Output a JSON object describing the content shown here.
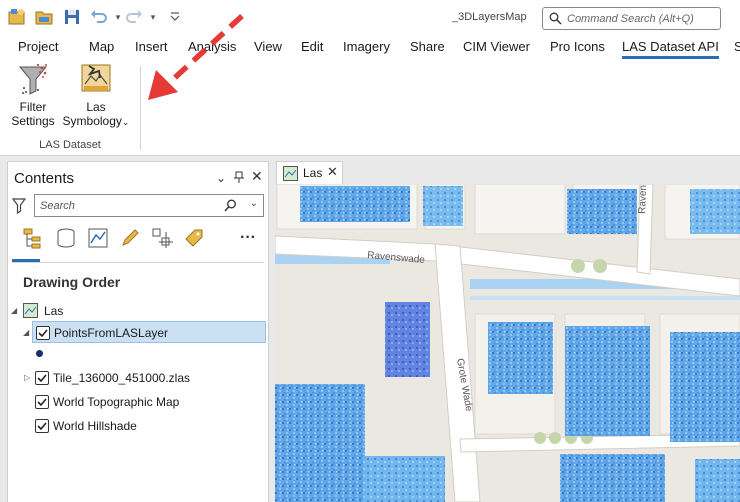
{
  "titlebar": {
    "app_title": "_3DLayersMap",
    "search_placeholder": "Command Search (Alt+Q)"
  },
  "tabs": [
    {
      "label": "Project"
    },
    {
      "label": "Map"
    },
    {
      "label": "Insert"
    },
    {
      "label": "Analysis"
    },
    {
      "label": "View"
    },
    {
      "label": "Edit"
    },
    {
      "label": "Imagery"
    },
    {
      "label": "Share"
    },
    {
      "label": "CIM Viewer"
    },
    {
      "label": "Pro Icons"
    },
    {
      "label": "LAS Dataset API"
    },
    {
      "label": "S"
    }
  ],
  "ribbon": {
    "filter_label_1": "Filter",
    "filter_label_2": "Settings",
    "symb_label_1": "Las",
    "symb_label_2": "Symbology",
    "group_label": "LAS Dataset"
  },
  "contents": {
    "title": "Contents",
    "search_placeholder": "Search",
    "section": "Drawing Order",
    "layers": [
      {
        "label": "Las"
      },
      {
        "label": "PointsFromLASLayer"
      },
      {
        "label": "Tile_136000_451000.zlas"
      },
      {
        "label": "World Topographic Map"
      },
      {
        "label": "World Hillshade"
      }
    ]
  },
  "map": {
    "tab_label": "Las",
    "labels": {
      "ravenswade": "Ravenswade",
      "grote_wade": "Grote Wade",
      "raven": "Raven"
    }
  },
  "colors": {
    "accent": "#2a6fb4",
    "selection": "#cce0f4",
    "arrow": "#e53a35",
    "points": "#3d8fe0",
    "water": "#a9d3f0"
  }
}
